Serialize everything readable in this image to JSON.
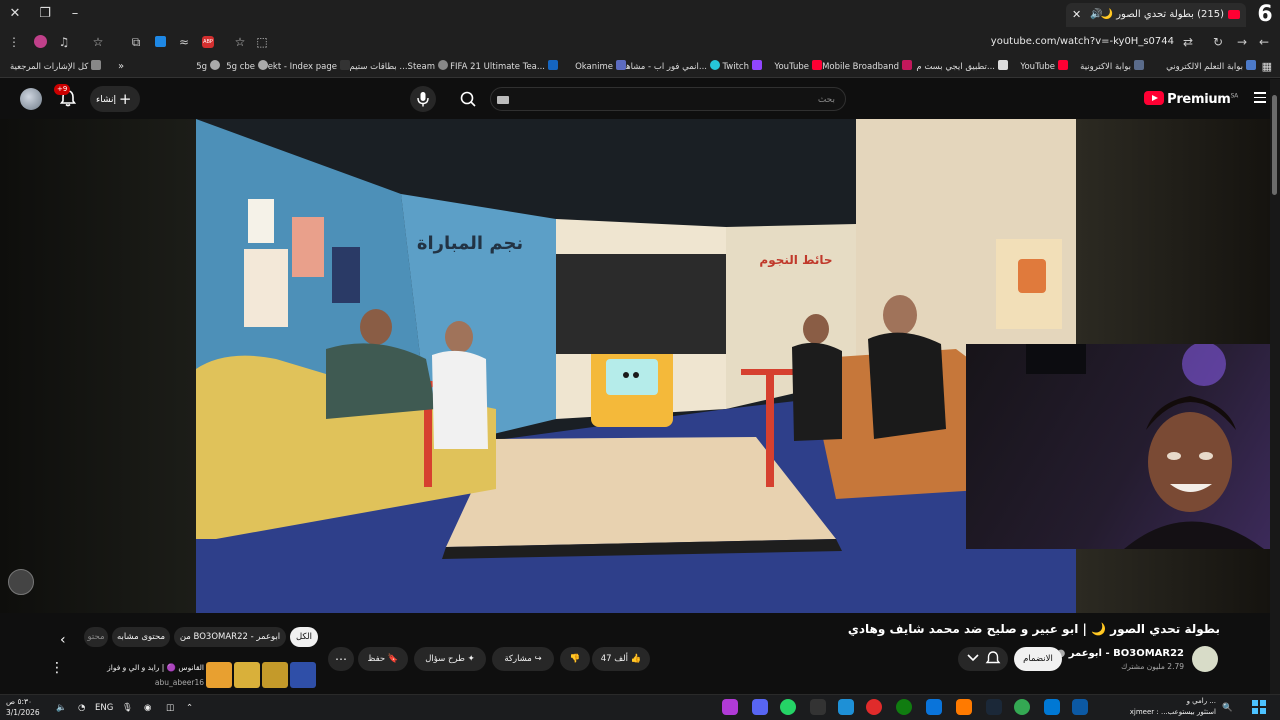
{
  "browser": {
    "tab_title": "(215) بطولة تحدي الصور 🌙",
    "url": "youtube.com/watch?v=-ky0H_s0744",
    "profile_number": "6",
    "bookmarks_all": "كل الإشارات المرجعية",
    "bookmarks": [
      "بوابة التعلم الالكتروني",
      "بوابة الاكترونية",
      "YouTube",
      "تطبيق ايجي بست م...",
      "Mobile Broadband",
      "YouTube",
      "Twitch",
      "انمي فور اب - مشاهد...",
      "Okanime",
      "FIFA 21 Ultimate Tea...",
      "بطاقات ستيم ...Steam",
      "rekt - Index page",
      "5g cbe",
      "5g"
    ]
  },
  "youtube": {
    "logo_text": "Premium",
    "logo_region": "SA",
    "search_placeholder": "بحث",
    "create_label": "إنشاء",
    "notifications_badge": "+9"
  },
  "video": {
    "title": "بطولة تحدي الصور 🌙 | ابو عبير و صليح ضد محمد شايف وهادي",
    "channel_name": "BO3OMAR22 - ابوعمر",
    "subscribers": "2.79 مليون مشترك",
    "join_label": "الانضمام",
    "likes": "47 ألف",
    "share_label": "مشاركة",
    "ask_label": "طرح سؤال",
    "save_label": "حفظ",
    "filter_chips": [
      "الكل",
      "من BO3OMAR22 - ابوعمر",
      "محتوى مشابه",
      "محتو"
    ],
    "viewer_line1": "القانوس 🟣 | رايد و الي و فواز",
    "viewer_line2": "abu_abeer16"
  },
  "taskbar": {
    "time": "٥:٣٠ ص",
    "date": "3/1/2026",
    "language": "ENG",
    "notification_line1": "رامي و ...",
    "notification_line2": "xjmeer : ...استثور بيستوعب"
  },
  "colors": {
    "youtube_red": "#ff0033",
    "background": "#0f0f0f",
    "chip_bg": "#272727"
  }
}
